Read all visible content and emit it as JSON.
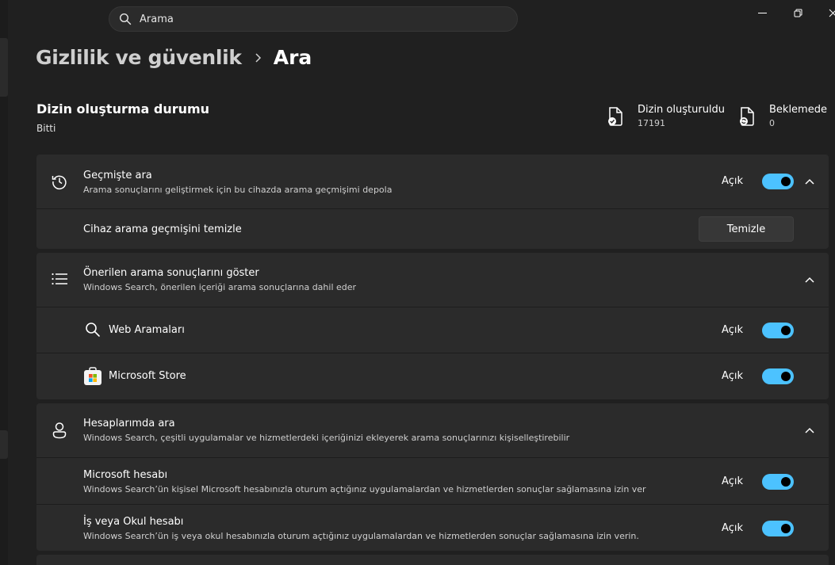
{
  "search": {
    "value": "Arama"
  },
  "window_controls": {
    "minimize": "minimize-icon",
    "restore": "restore-icon",
    "close": "close-icon"
  },
  "breadcrumb": {
    "parent": "Gizlilik ve güvenlik",
    "current": "Ara"
  },
  "indexing": {
    "title": "Dizin oluşturma durumu",
    "status": "Bitti",
    "indexed_label": "Dizin oluşturuldu",
    "indexed_count": "17191",
    "pending_label": "Beklemede",
    "pending_count": "0"
  },
  "history": {
    "title": "Geçmişte ara",
    "desc": "Arama sonuçlarını geliştirmek için bu cihazda arama geçmişimi depola",
    "state": "Açık",
    "clear_label": "Cihaz arama geçmişini temizle",
    "clear_button": "Temizle"
  },
  "suggested": {
    "title": "Önerilen arama sonuçlarını göster",
    "desc": "Windows Search, önerilen içeriği arama sonuçlarına dahil eder",
    "items": [
      {
        "label": "Web Aramaları",
        "state": "Açık",
        "icon": "search-icon"
      },
      {
        "label": "Microsoft Store",
        "state": "Açık",
        "icon": "microsoft-store-icon"
      }
    ]
  },
  "accounts": {
    "title": "Hesaplarımda ara",
    "desc": "Windows Search, çeşitli uygulamalar ve hizmetlerdeki içeriğinizi ekleyerek arama sonuçlarınızı kişiselleştirebilir",
    "items": [
      {
        "title": "Microsoft hesabı",
        "desc": "Windows Search’ün kişisel Microsoft hesabınızla oturum açtığınız uygulamalardan ve hizmetlerden sonuçlar sağlamasına izin ver",
        "state": "Açık"
      },
      {
        "title": "İş veya Okul hesabı",
        "desc": "Windows Search’ün iş veya okul hesabınızla oturum açtığınız uygulamalardan ve hizmetlerden sonuçlar sağlamasına izin verin.",
        "state": "Açık"
      }
    ]
  },
  "colors": {
    "accent": "#4cc2ff",
    "background": "#202020",
    "card": "#2b2b2b"
  }
}
